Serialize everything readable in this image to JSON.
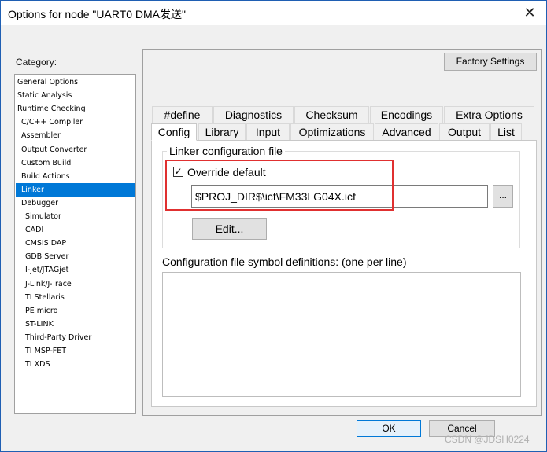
{
  "window": {
    "title": "Options for node \"UART0 DMA发送\"",
    "close_glyph": "✕"
  },
  "category": {
    "label": "Category:",
    "items": [
      {
        "label": "General Options"
      },
      {
        "label": "Static Analysis"
      },
      {
        "label": "Runtime Checking"
      },
      {
        "label": "C/C++ Compiler"
      },
      {
        "label": "Assembler"
      },
      {
        "label": "Output Converter"
      },
      {
        "label": "Custom Build"
      },
      {
        "label": "Build Actions"
      },
      {
        "label": "Linker"
      },
      {
        "label": "Debugger"
      },
      {
        "label": "Simulator"
      },
      {
        "label": "CADI"
      },
      {
        "label": "CMSIS DAP"
      },
      {
        "label": "GDB Server"
      },
      {
        "label": "I-jet/JTAGjet"
      },
      {
        "label": "J-Link/J-Trace"
      },
      {
        "label": "TI Stellaris"
      },
      {
        "label": "PE micro"
      },
      {
        "label": "ST-LINK"
      },
      {
        "label": "Third-Party Driver"
      },
      {
        "label": "TI MSP-FET"
      },
      {
        "label": "TI XDS"
      }
    ],
    "selected": "Linker"
  },
  "factory_settings_label": "Factory Settings",
  "tabs": {
    "row1": [
      "#define",
      "Diagnostics",
      "Checksum",
      "Encodings",
      "Extra Options"
    ],
    "row2": [
      "Config",
      "Library",
      "Input",
      "Optimizations",
      "Advanced",
      "Output",
      "List"
    ],
    "active": "Config"
  },
  "config": {
    "group_title": "Linker configuration file",
    "override_label": "Override default",
    "override_checked": "☑",
    "check_glyph": "✓",
    "path_value": "$PROJ_DIR$\\icf\\FM33LG04X.icf",
    "browse_label": "...",
    "edit_label": "Edit...",
    "symbols_label": "Configuration file symbol definitions: (one per line)",
    "symbols_value": ""
  },
  "buttons": {
    "ok": "OK",
    "cancel": "Cancel"
  },
  "watermark": "CSDN @JDSH0224",
  "colors": {
    "selection": "#0078d7",
    "highlight_box": "#e03030"
  },
  "icons": {
    "scroll_up": "scroll-up-arrow-icon",
    "scroll_down": "scroll-down-arrow-icon",
    "close": "close-icon"
  }
}
